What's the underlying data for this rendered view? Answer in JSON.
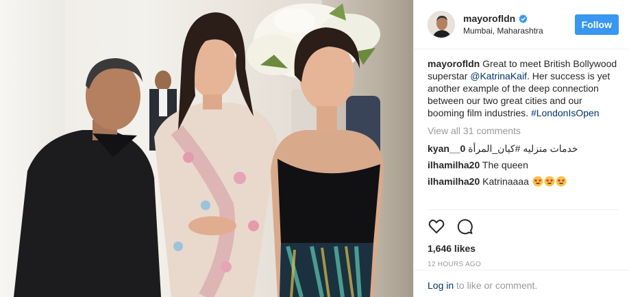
{
  "post": {
    "username": "mayorofldn",
    "location": "Mumbai, Maharashtra",
    "follow_label": "Follow",
    "caption": {
      "username": "mayorofldn",
      "text_part1": "Great to meet British Bollywood superstar",
      "mention": "@KatrinaKaif",
      "text_part2": ". Her success is yet another example of the deep connection between our two great cities and our booming film industries.",
      "hashtag": "#LondonIsOpen"
    },
    "view_all_label": "View all 31 comments",
    "comments": [
      {
        "username": "kyan__0",
        "text": "خدمات منزليه  #كيان_المرأة"
      },
      {
        "username": "ilhamilha20",
        "text": "The queen"
      },
      {
        "username": "ilhamilha20",
        "text": "Katrinaaaa"
      }
    ],
    "likes": "1,646 likes",
    "time": "12 HOURS AGO",
    "login_link": "Log in",
    "login_rest": " to like or comment.",
    "icons": {
      "verified": "verified-badge-icon",
      "like": "heart-outline-icon",
      "comment": "speech-bubble-icon",
      "emoji": "heart-eyes-emoji"
    },
    "colors": {
      "follow_button": "#3897f0",
      "link": "#003569",
      "muted": "#999999",
      "text": "#262626"
    }
  }
}
